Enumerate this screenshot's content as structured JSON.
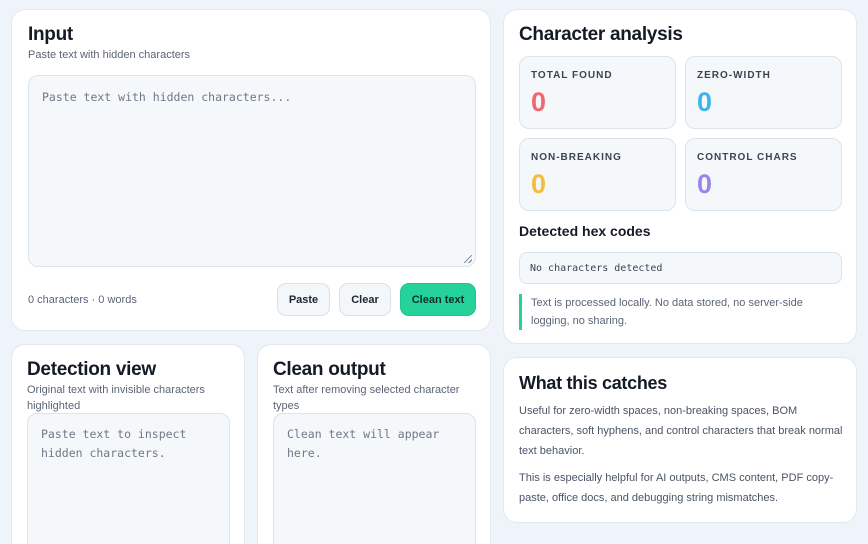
{
  "input": {
    "title": "Input",
    "subtitle": "Paste text with hidden characters",
    "placeholder": "Paste text with hidden characters...",
    "counts": "0 characters · 0 words",
    "paste_label": "Paste",
    "clear_label": "Clear",
    "clean_label": "Clean text"
  },
  "analysis": {
    "title": "Character analysis",
    "stats": [
      {
        "label": "TOTAL FOUND",
        "value": "0",
        "color": "#f0676d"
      },
      {
        "label": "ZERO-WIDTH",
        "value": "0",
        "color": "#3fb3ea"
      },
      {
        "label": "NON-BREAKING",
        "value": "0",
        "color": "#f5bd3a"
      },
      {
        "label": "CONTROL CHARS",
        "value": "0",
        "color": "#9b86e8"
      }
    ],
    "hex_title": "Detected hex codes",
    "hex_value": "No characters detected",
    "privacy_note": "Text is processed locally. No data stored, no server-side logging, no sharing."
  },
  "detection": {
    "title": "Detection view",
    "subtitle": "Original text with invisible characters highlighted",
    "placeholder": "Paste text to inspect hidden characters."
  },
  "output": {
    "title": "Clean output",
    "subtitle": "Text after removing selected character types",
    "placeholder": "Clean text will appear here."
  },
  "catches": {
    "title": "What this catches",
    "para1": "Useful for zero-width spaces, non-breaking spaces, BOM characters, soft hyphens, and control characters that break normal text behavior.",
    "para2": "This is especially helpful for AI outputs, CMS content, PDF copy-paste, office docs, and debugging string mismatches."
  },
  "accent": "#25d39a"
}
